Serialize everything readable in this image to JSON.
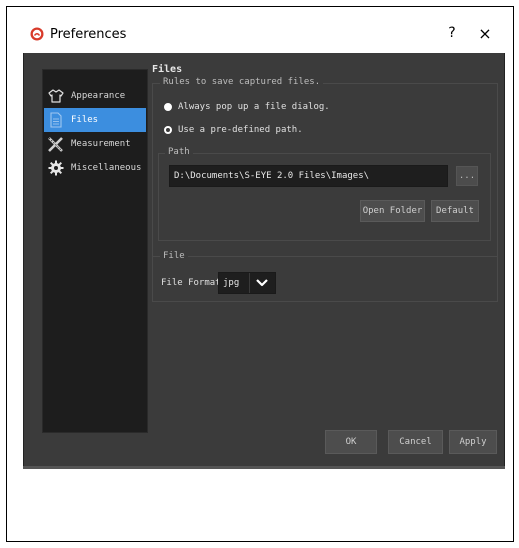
{
  "window": {
    "title": "Preferences",
    "help_label": "?",
    "close_label": "×"
  },
  "sidebar": {
    "items": [
      {
        "label": "Appearance",
        "icon": "shirt-icon",
        "active": false
      },
      {
        "label": "Files",
        "icon": "document-icon",
        "active": true
      },
      {
        "label": "Measurement",
        "icon": "ruler-cross-icon",
        "active": false
      },
      {
        "label": "Miscellaneous",
        "icon": "gear-icon",
        "active": false
      }
    ]
  },
  "files": {
    "section_title": "Files",
    "rules_legend": "Rules to save captured files.",
    "options": [
      {
        "label": "Always pop up a file dialog.",
        "selected": true
      },
      {
        "label": "Use a pre-defined path.",
        "selected": false
      }
    ],
    "path_legend": "Path",
    "path_value": "D:\\Documents\\S-EYE 2.0 Files\\Images\\",
    "browse_label": "...",
    "open_folder_label": "Open Folder",
    "default_label": "Default",
    "file_legend": "File",
    "file_format_label": "File Format",
    "file_format_value": "jpg"
  },
  "footer": {
    "ok_label": "OK",
    "cancel_label": "Cancel",
    "apply_label": "Apply"
  },
  "colors": {
    "accent": "#3c8edf",
    "background": "#3b3b3b",
    "sidebar": "#1d1d1d"
  }
}
